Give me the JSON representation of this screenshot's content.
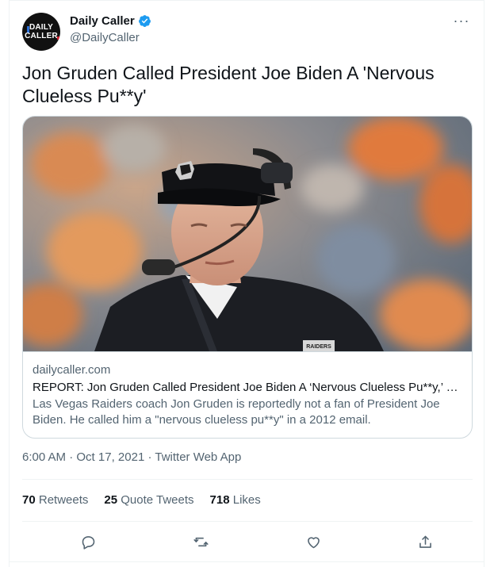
{
  "account": {
    "display_name": "Daily Caller",
    "handle": "@DailyCaller",
    "avatar_text_line1": "DAILY",
    "avatar_text_line2": "CALLER",
    "verified": true
  },
  "tweet": {
    "text": "Jon Gruden Called President Joe Biden A 'Nervous Clueless Pu**y'"
  },
  "card": {
    "domain": "dailycaller.com",
    "title": "REPORT: Jon Gruden Called President Joe Biden A ‘Nervous Clueless Pu**y,’ Ca...",
    "description": "Las Vegas Raiders coach Jon Gruden is reportedly not a fan of President Joe Biden. He called him a \"nervous clueless pu**y\" in a 2012 email.",
    "visor_logo_text": "RAIDERS"
  },
  "meta": {
    "time": "6:00 AM",
    "separator": " · ",
    "date": "Oct 17, 2021",
    "source": "Twitter Web App"
  },
  "stats": {
    "retweets_count": "70",
    "retweets_label": " Retweets",
    "quotes_count": "25",
    "quotes_label": " Quote Tweets",
    "likes_count": "718",
    "likes_label": " Likes"
  },
  "icons": {
    "more": "more-icon",
    "reply": "reply-icon",
    "retweet": "retweet-icon",
    "like": "like-icon",
    "share": "share-icon",
    "verified": "verified-badge-icon"
  },
  "colors": {
    "text_primary": "#0f1419",
    "text_secondary": "#536471",
    "verified_blue": "#1d9bf0",
    "border": "#cfd9de",
    "divider": "#eff3f4"
  }
}
